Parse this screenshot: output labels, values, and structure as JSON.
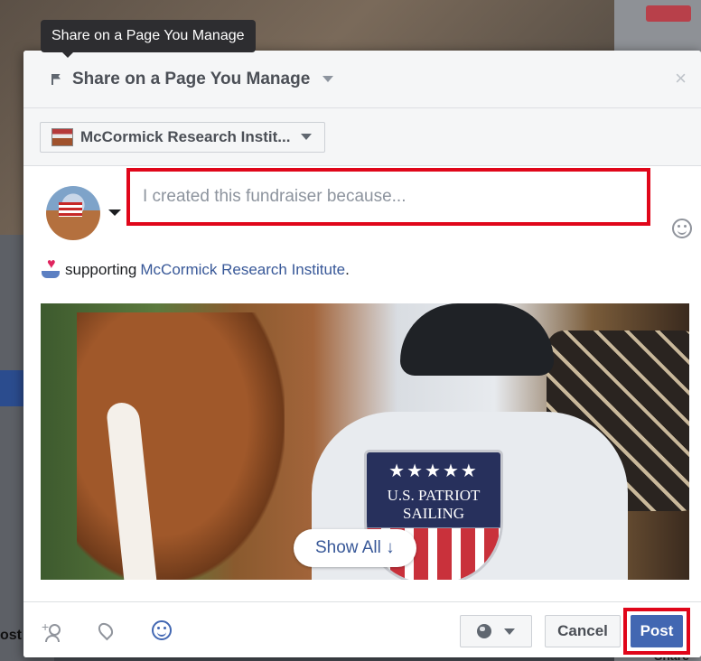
{
  "tooltip": {
    "text": "Share on a Page You Manage"
  },
  "header": {
    "title": "Share on a Page You Manage",
    "close_label": "×"
  },
  "page_selector": {
    "name": "McCormick Research Instit..."
  },
  "composer": {
    "placeholder": "I created this fundraiser because..."
  },
  "supporting": {
    "prefix": "supporting",
    "link": "McCormick Research Institute",
    "suffix": "."
  },
  "attachment": {
    "shield_stars": "★★★★★",
    "shield_line1": "U.S. PATRIOT",
    "shield_line2": "SAILING",
    "show_all_label": "Show All ↓"
  },
  "footer": {
    "cancel_label": "Cancel",
    "post_label": "Post"
  },
  "background": {
    "post_fragment": "ost",
    "share_fragment": "Share"
  },
  "colors": {
    "accent": "#4267b2",
    "link": "#385898",
    "highlight": "#e0061a"
  }
}
